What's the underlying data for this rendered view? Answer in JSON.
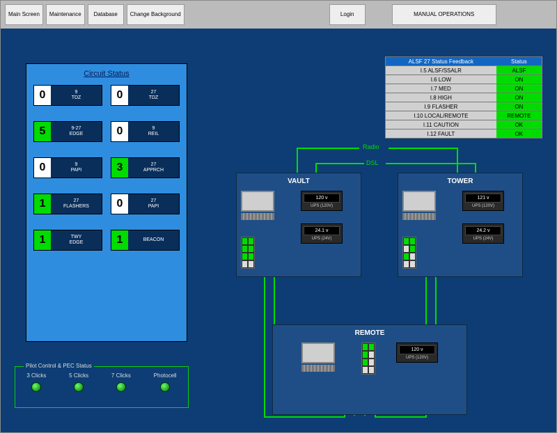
{
  "topbar": {
    "main_screen": "Main Screen",
    "maintenance": "Maintenance",
    "database": "Database",
    "change_background": "Change Background",
    "login": "Login",
    "manual_ops": "MANUAL OPERATIONS"
  },
  "circuit": {
    "title": "Circuit Status",
    "tiles": [
      {
        "count": "0",
        "hi": false,
        "l1": "9",
        "l2": "TDZ"
      },
      {
        "count": "0",
        "hi": false,
        "l1": "27",
        "l2": "TDZ"
      },
      {
        "count": "5",
        "hi": true,
        "l1": "9-27",
        "l2": "EDGE"
      },
      {
        "count": "0",
        "hi": false,
        "l1": "9",
        "l2": "REIL"
      },
      {
        "count": "0",
        "hi": false,
        "l1": "9",
        "l2": "PAPI"
      },
      {
        "count": "3",
        "hi": true,
        "l1": "27",
        "l2": "APPRCH"
      },
      {
        "count": "1",
        "hi": true,
        "l1": "27",
        "l2": "FLASHERS"
      },
      {
        "count": "0",
        "hi": false,
        "l1": "27",
        "l2": "PAPI"
      },
      {
        "count": "1",
        "hi": true,
        "l1": "TWY",
        "l2": "EDGE"
      },
      {
        "count": "1",
        "hi": true,
        "l1": "BEACON",
        "l2": ""
      }
    ]
  },
  "pilot": {
    "title": "Pilot Control & PEC Status",
    "items": [
      "3 Clicks",
      "5 Clicks",
      "7 Clicks",
      "Photocell"
    ]
  },
  "feedback": {
    "h1": "ALSF 27 Status Feedback",
    "h2": "Status",
    "rows": [
      {
        "label": "I.5 ALSF/SSALR",
        "val": "ALSF"
      },
      {
        "label": "I.6 LOW",
        "val": "ON"
      },
      {
        "label": "I.7 MED",
        "val": "ON"
      },
      {
        "label": "I.8 HIGH",
        "val": "ON"
      },
      {
        "label": "I.9 FLASHER",
        "val": "ON"
      },
      {
        "label": "I.10 LOCAL/REMOTE",
        "val": "REMOTE"
      },
      {
        "label": "I.11 CAUTION",
        "val": "OK"
      },
      {
        "label": "I.12 FAULT",
        "val": "OK"
      }
    ]
  },
  "links": {
    "radio": "Radio",
    "dsl": "DSL"
  },
  "nodes": {
    "vault": {
      "title": "VAULT",
      "ups": [
        {
          "v": "120 v",
          "lbl": "UPS (120V)"
        },
        {
          "v": "24.1 v",
          "lbl": "UPS (24V)"
        }
      ],
      "switch": [
        "on",
        "on",
        "on",
        "on",
        "on",
        "on",
        "off",
        "off"
      ]
    },
    "tower": {
      "title": "TOWER",
      "ups": [
        {
          "v": "121 v",
          "lbl": "UPS (120V)"
        },
        {
          "v": "24.2 v",
          "lbl": "UPS (24V)"
        }
      ],
      "switch": [
        "on",
        "on",
        "off",
        "on",
        "on",
        "off",
        "off",
        "off"
      ]
    },
    "remote": {
      "title": "REMOTE",
      "ups": [
        {
          "v": "120 v",
          "lbl": "UPS (120V)"
        }
      ],
      "switch": [
        "on",
        "on",
        "on",
        "off",
        "on",
        "off",
        "off",
        "off"
      ]
    }
  }
}
